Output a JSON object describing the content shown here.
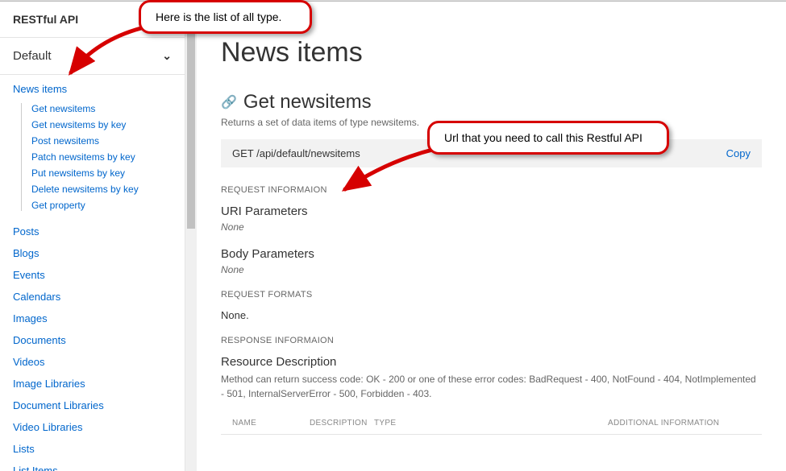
{
  "sidebar": {
    "header": "RESTful API",
    "dropdown": "Default",
    "active_item": "News items",
    "sub_items": [
      "Get newsitems",
      "Get newsitems by key",
      "Post newsitems",
      "Patch newsitems by key",
      "Put newsitems by key",
      "Delete newsitems by key",
      "Get property"
    ],
    "items": [
      "Posts",
      "Blogs",
      "Events",
      "Calendars",
      "Images",
      "Documents",
      "Videos",
      "Image Libraries",
      "Document Libraries",
      "Video Libraries",
      "Lists",
      "List Items"
    ]
  },
  "main": {
    "title": "News items",
    "section_title": "Get newsitems",
    "section_desc": "Returns a set of data items of type newsitems.",
    "endpoint": "GET /api/default/newsitems",
    "copy_label": "Copy",
    "request_info_label": "REQUEST INFORMAION",
    "uri_params_label": "URI Parameters",
    "uri_params_value": "None",
    "body_params_label": "Body Parameters",
    "body_params_value": "None",
    "request_formats_label": "REQUEST FORMATS",
    "request_formats_value": "None.",
    "response_info_label": "RESPONSE INFORMAION",
    "resource_desc_label": "Resource Description",
    "resource_desc_text": "Method can return success code: OK - 200 or one of these error codes: BadRequest - 400, NotFound - 404, NotImplemented - 501, InternalServerError - 500, Forbidden - 403.",
    "table": {
      "col_name": "NAME",
      "col_desc": "DESCRIPTION",
      "col_type": "TYPE",
      "col_add": "ADDITIONAL INFORMATION"
    }
  },
  "annotations": {
    "callout1": "Here is the list of all type.",
    "callout2": "Url that you need to call this Restful API"
  },
  "colors": {
    "link": "#0066cc",
    "annotation_red": "#d60000"
  }
}
